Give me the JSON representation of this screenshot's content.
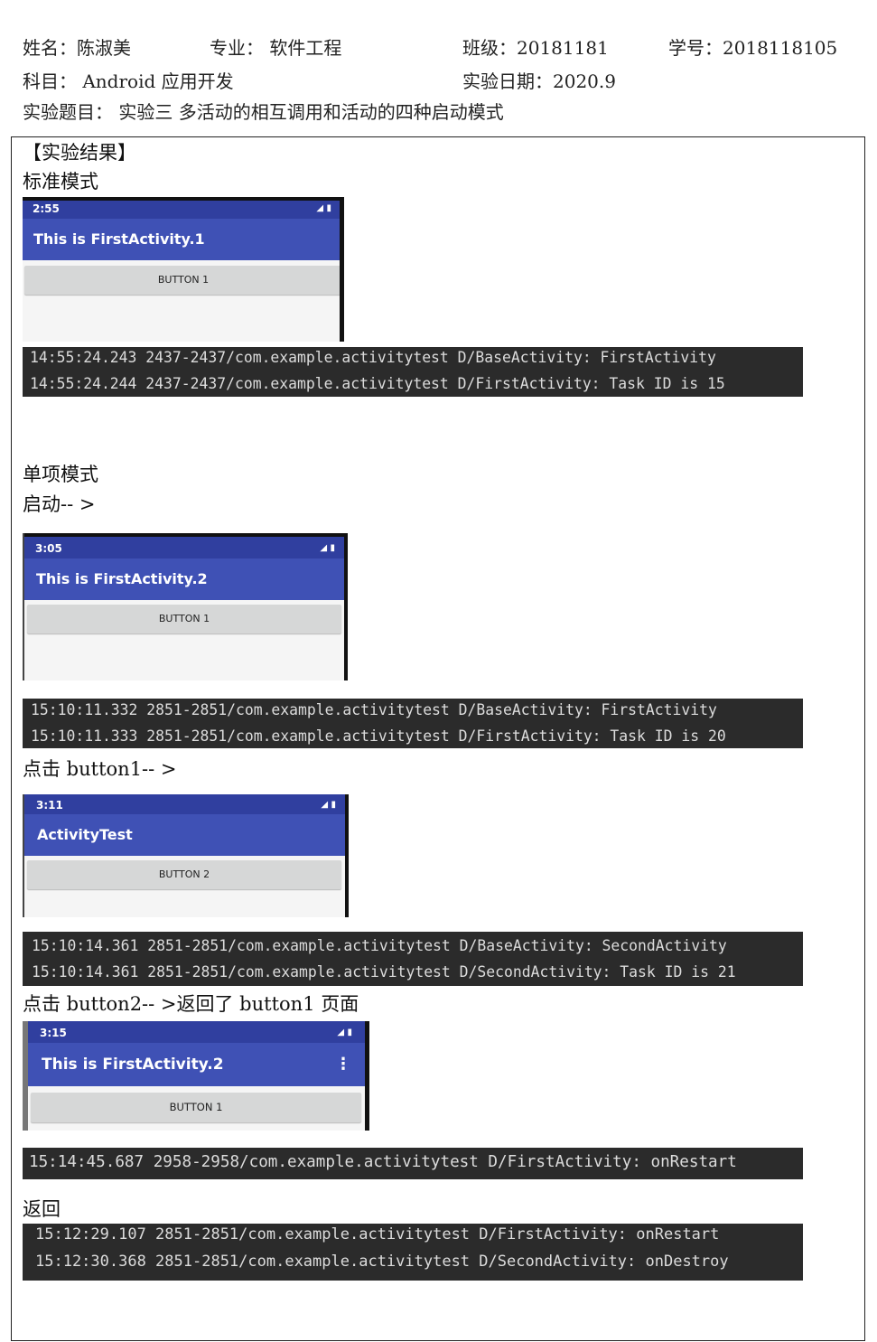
{
  "header": {
    "name": "姓名：陈淑美",
    "major": "专业：  软件工程",
    "class": "班级：20181181",
    "student_id": "学号：2018118105",
    "subject": "科目：  Android 应用开发",
    "date": "实验日期：2020.9",
    "topic": "实验题目：  实验三  多活动的相互调用和活动的四种启动模式"
  },
  "section_title": "【实验结果】",
  "labels": {
    "standard_mode": "标准模式",
    "single_top_mode": "单项模式",
    "start": "启动-- >",
    "click_button1": "点击 button1-- >",
    "click_button2": "点击 button2-- >返回了 button1 页面",
    "back": "返回"
  },
  "screens": [
    {
      "time": "2:55",
      "title": "This is FirstActivity.1",
      "button": "BUTTON 1",
      "menu": ""
    },
    {
      "time": "3:05",
      "title": "This is FirstActivity.2",
      "button": "BUTTON 1",
      "menu": ""
    },
    {
      "time": "3:11",
      "title": "ActivityTest",
      "button": "BUTTON 2",
      "menu": ""
    },
    {
      "time": "3:15",
      "title": "This is FirstActivity.2",
      "button": "BUTTON 1",
      "menu": "⋮"
    }
  ],
  "signal_icon": "◢ ▮",
  "logs": [
    [
      "14:55:24.243 2437-2437/com.example.activitytest D/BaseActivity: FirstActivity",
      "14:55:24.244 2437-2437/com.example.activitytest D/FirstActivity: Task ID is 15"
    ],
    [
      "15:10:11.332 2851-2851/com.example.activitytest D/BaseActivity: FirstActivity",
      "15:10:11.333 2851-2851/com.example.activitytest D/FirstActivity: Task ID is 20"
    ],
    [
      "15:10:14.361 2851-2851/com.example.activitytest D/BaseActivity: SecondActivity",
      "15:10:14.361 2851-2851/com.example.activitytest D/SecondActivity: Task ID is 21"
    ],
    [
      "15:14:45.687 2958-2958/com.example.activitytest D/FirstActivity: onRestart"
    ],
    [
      "15:12:29.107 2851-2851/com.example.activitytest D/FirstActivity: onRestart",
      "15:12:30.368 2851-2851/com.example.activitytest D/SecondActivity: onDestroy"
    ]
  ]
}
